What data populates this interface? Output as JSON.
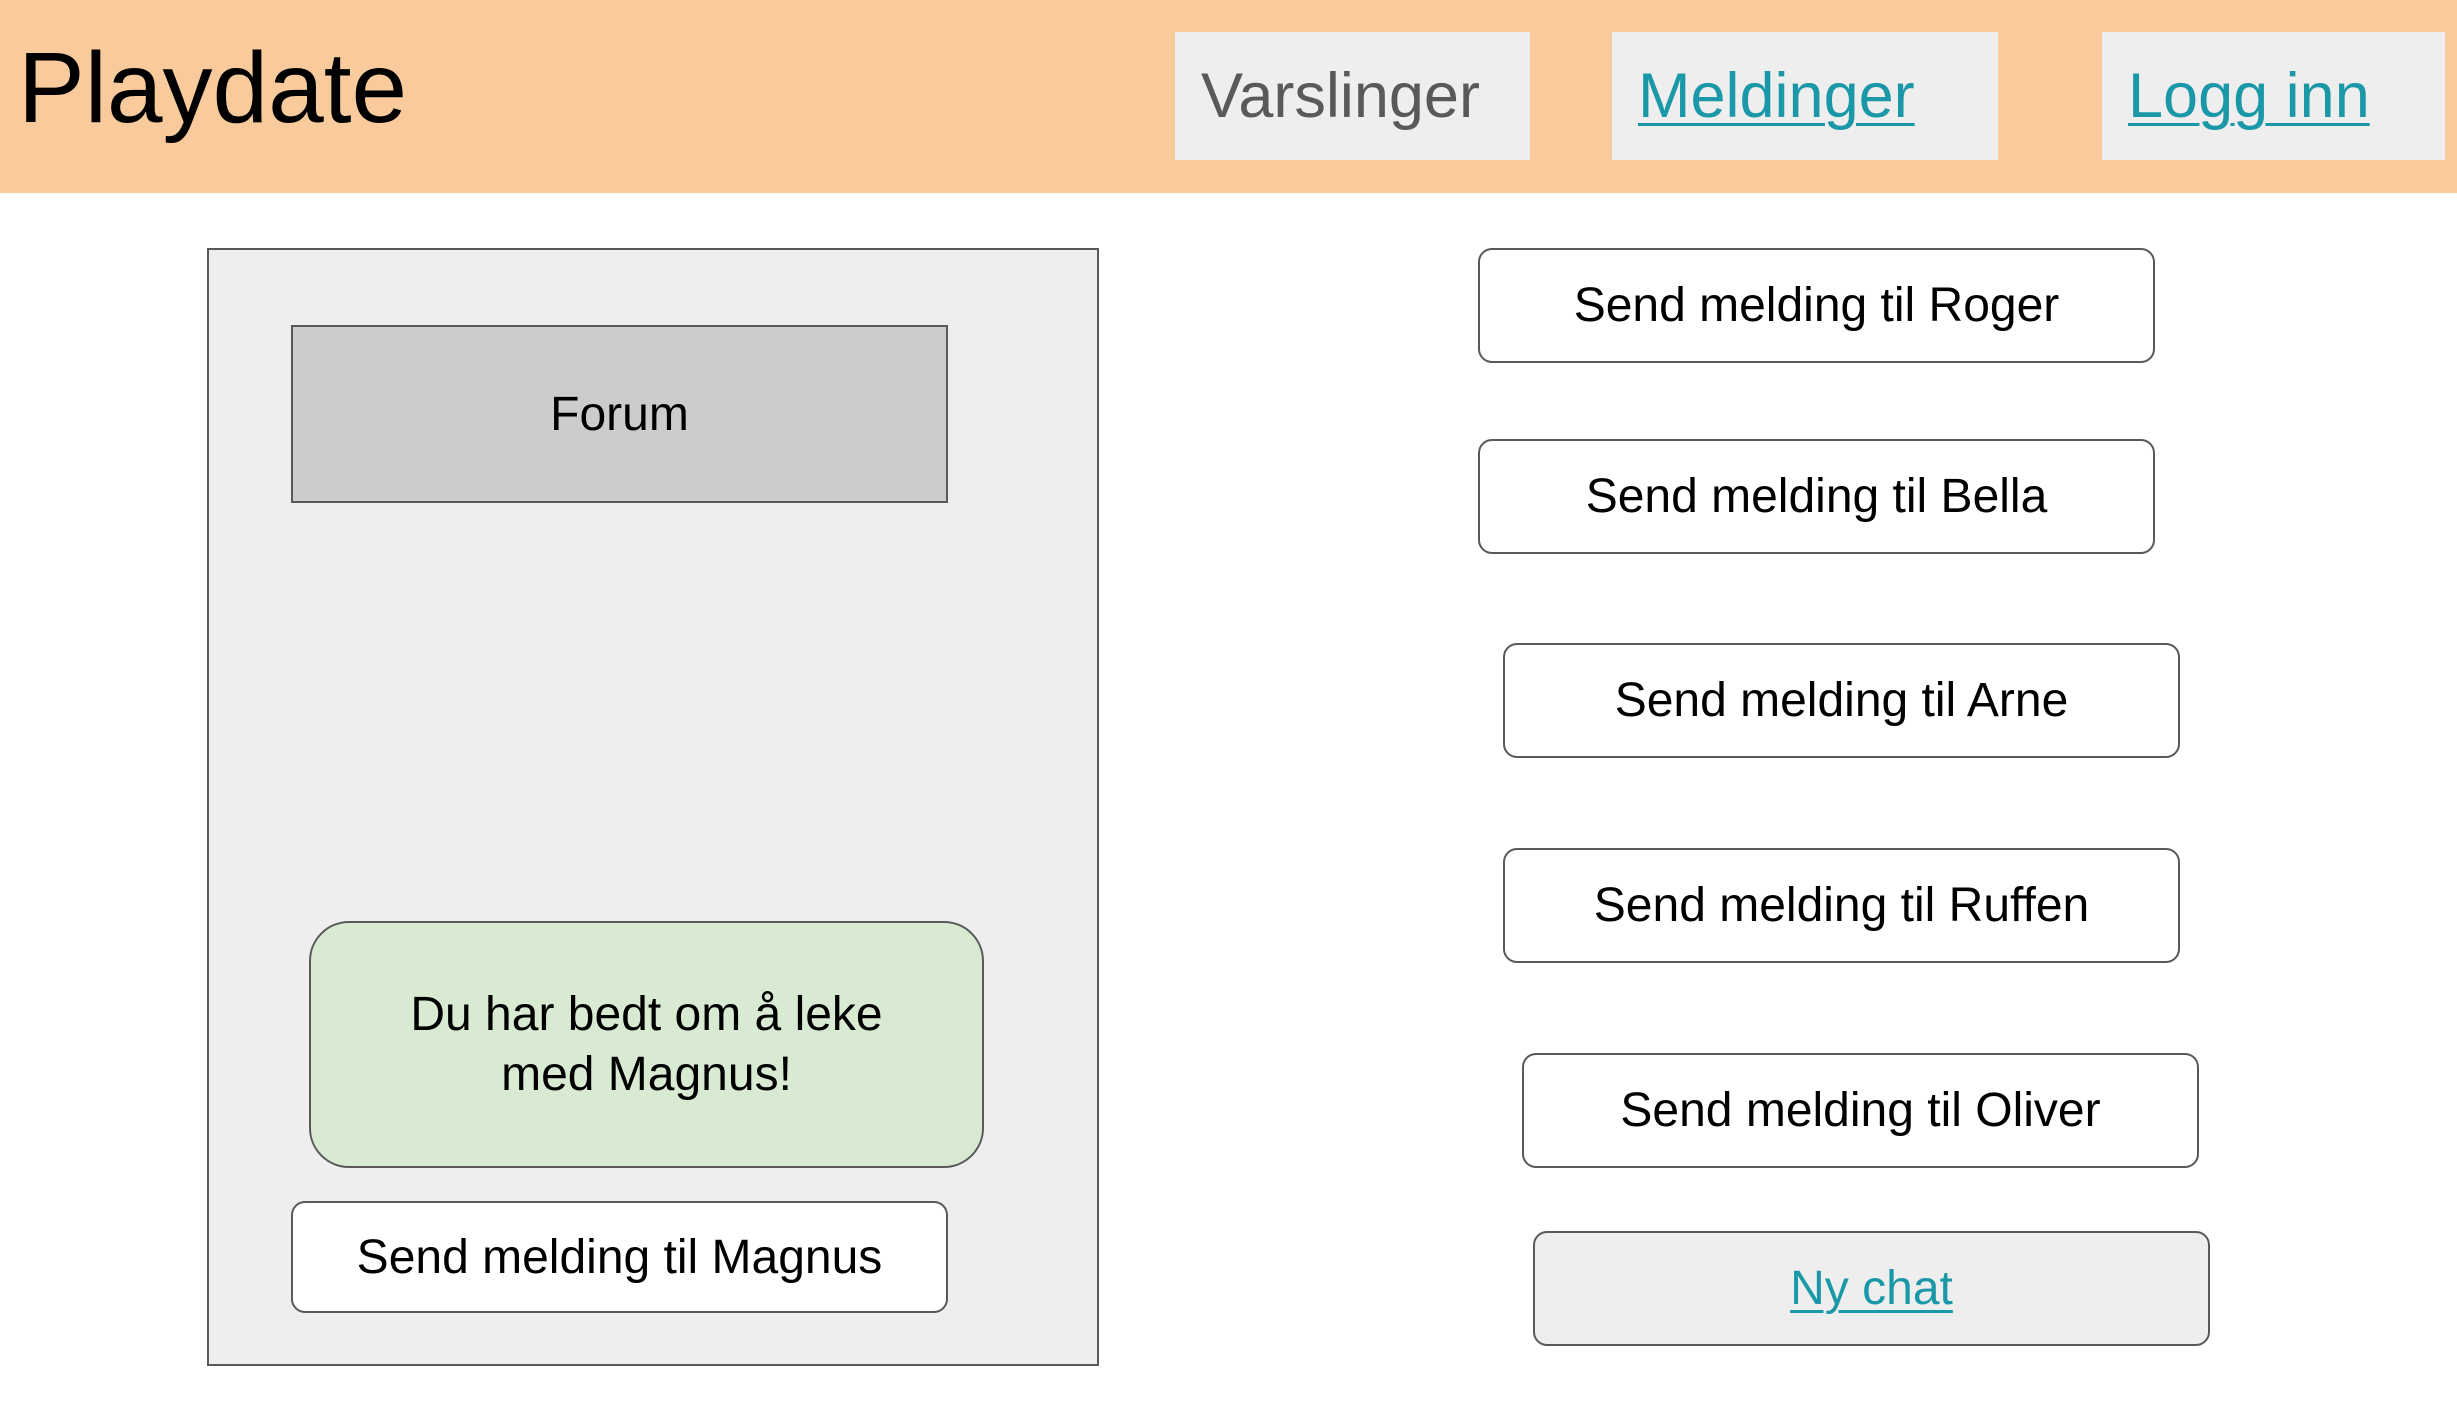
{
  "header": {
    "brand": "Playdate",
    "nav": {
      "notifications": "Varslinger",
      "messages": "Meldinger",
      "login": "Logg inn"
    }
  },
  "panel": {
    "forum_label": "Forum",
    "notice": "Du har bedt om å leke med Magnus!",
    "send_magnus": "Send melding til Magnus"
  },
  "contacts": {
    "roger": "Send melding til Roger",
    "bella": "Send melding til Bella",
    "arne": "Send melding til Arne",
    "ruffen": "Send melding til Ruffen",
    "oliver": "Send melding til Oliver"
  },
  "new_chat": "Ny chat",
  "colors": {
    "header_bg": "#f9cb9c",
    "link": "#1a98a8",
    "panel_bg": "#eeeeee",
    "forum_bg": "#cccccc",
    "notice_bg": "#d9ead3",
    "border": "#595959"
  }
}
